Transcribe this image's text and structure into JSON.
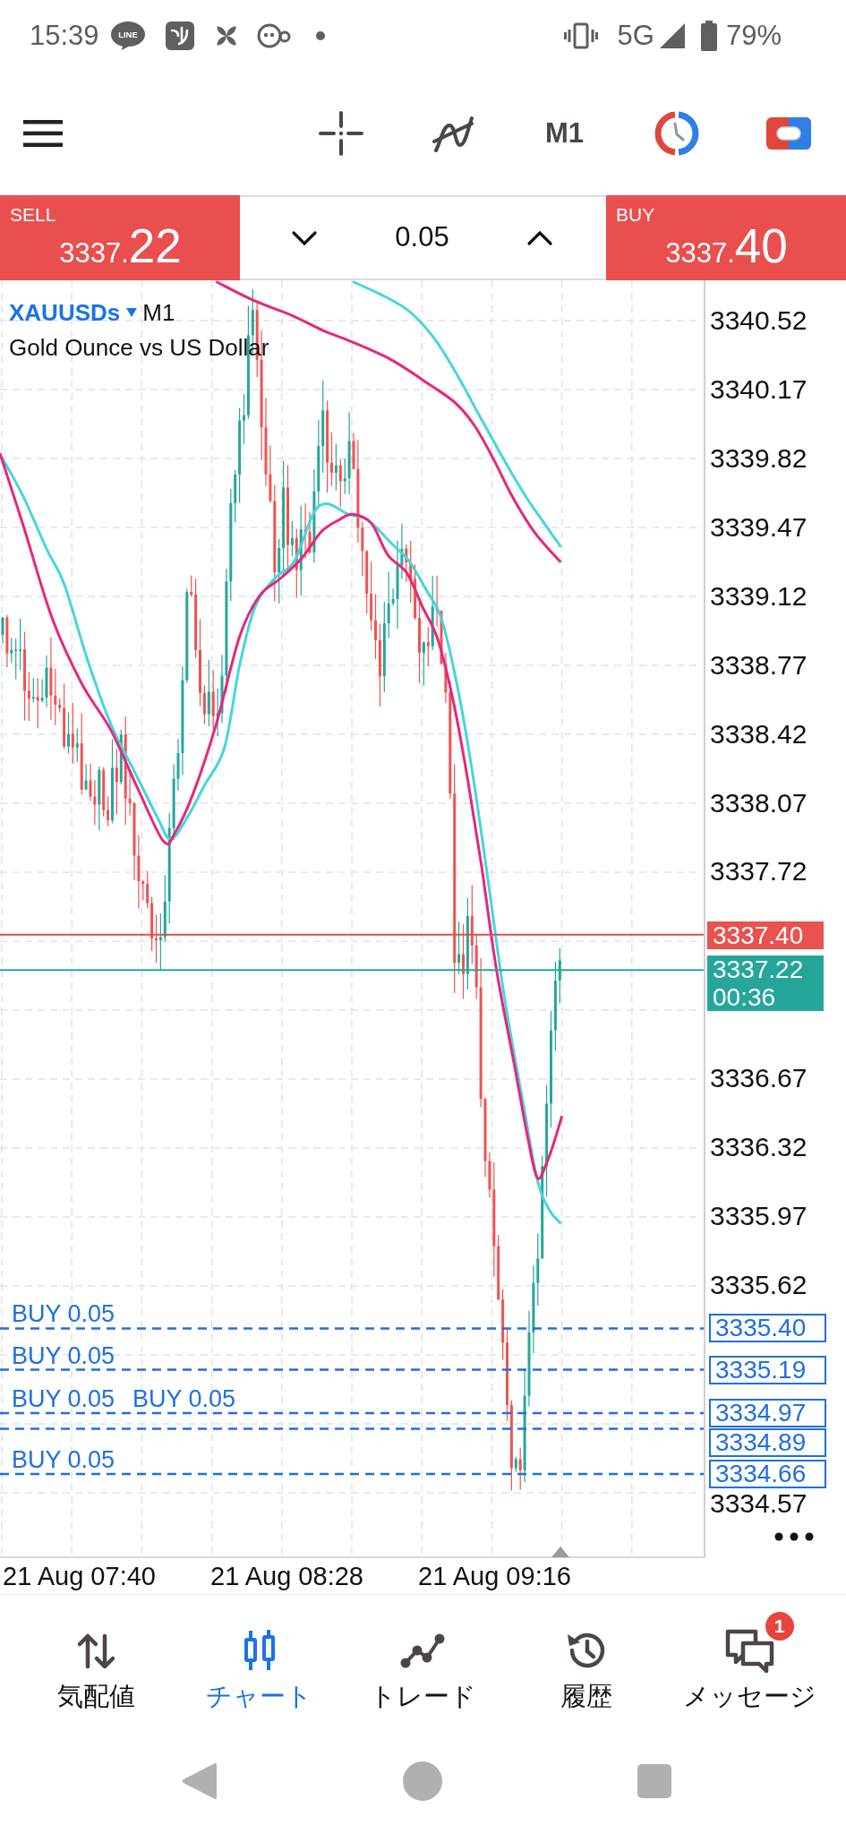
{
  "status_bar": {
    "time": "15:39",
    "chat_icon_text": "LINE",
    "network": "5G",
    "battery": "79%"
  },
  "toolbar": {
    "timeframe": "M1"
  },
  "trade_panel": {
    "sell": {
      "label": "SELL",
      "price_prefix": "3337.",
      "price_suffix": "22",
      "price_falling": true
    },
    "volume": "0.05",
    "buy": {
      "label": "BUY",
      "price_prefix": "3337.",
      "price_suffix": "40",
      "price_falling": true
    }
  },
  "chart": {
    "symbol": "XAUUSDs",
    "timeframe": "M1",
    "description": "Gold Ounce vs US Dollar",
    "price_axis": [
      "3340.52",
      "3340.17",
      "3339.82",
      "3339.47",
      "3339.12",
      "3338.77",
      "3338.42",
      "3338.07",
      "3337.72",
      "3336.67",
      "3336.32",
      "3335.97",
      "3335.62",
      "3334.57"
    ],
    "ask": {
      "price": "3337.40"
    },
    "bid": {
      "price": "3337.22",
      "countdown": "00:36"
    },
    "orders": [
      {
        "label": "BUY 0.05",
        "price": "3335.40"
      },
      {
        "label": "BUY 0.05",
        "price": "3335.19"
      },
      {
        "label": "BUY 0.05",
        "price": "3334.97"
      },
      {
        "label": "BUY 0.05",
        "price": "3334.89"
      },
      {
        "label": "BUY 0.05",
        "price": "3334.66"
      }
    ],
    "time_axis": [
      "21 Aug 07:40",
      "21 Aug 08:28",
      "21 Aug 09:16"
    ]
  },
  "bottom_nav": [
    {
      "label": "気配値",
      "selected": false
    },
    {
      "label": "チャート",
      "selected": true
    },
    {
      "label": "トレード",
      "selected": false
    },
    {
      "label": "履歴",
      "selected": false
    },
    {
      "label": "メッセージ",
      "selected": false,
      "badge": "1"
    }
  ]
}
